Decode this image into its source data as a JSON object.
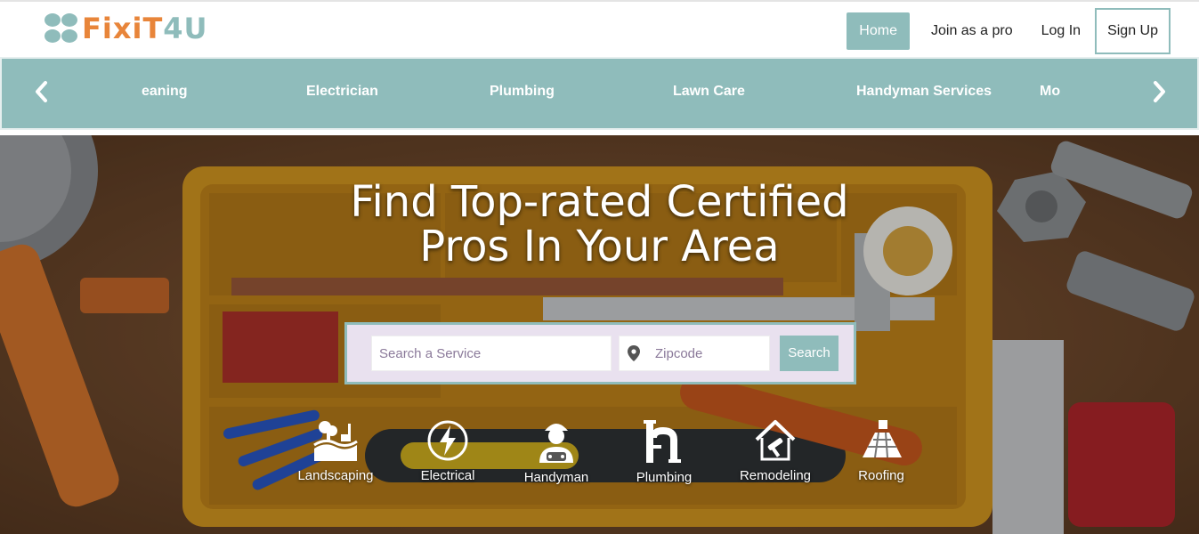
{
  "brand": {
    "part1": "FixiT",
    "part2": "4U",
    "color_primary": "#e8853a",
    "color_secondary": "#8fbcbb"
  },
  "nav": {
    "home": "Home",
    "join": "Join as a pro",
    "login": "Log In",
    "signup": "Sign Up"
  },
  "categories": {
    "prev_icon": "chevron-left-icon",
    "next_icon": "chevron-right-icon",
    "items": [
      "eaning",
      "Electrician",
      "Plumbing",
      "Lawn Care",
      "Handyman Services",
      "Mo"
    ]
  },
  "hero": {
    "title_line1": "Find Top-rated Certified",
    "title_line2": "Pros In Your Area"
  },
  "search": {
    "service_placeholder": "Search a Service",
    "zip_placeholder": "Zipcode",
    "button": "Search"
  },
  "services": [
    {
      "label": "Landscaping",
      "icon": "landscaping-icon"
    },
    {
      "label": "Electrical",
      "icon": "lightning-icon"
    },
    {
      "label": "Handyman",
      "icon": "handyman-icon"
    },
    {
      "label": "Plumbing",
      "icon": "pipe-icon"
    },
    {
      "label": "Remodeling",
      "icon": "house-hammer-icon"
    },
    {
      "label": "Roofing",
      "icon": "roof-icon"
    }
  ],
  "colors": {
    "accent": "#8fbcbb",
    "search_panel": "#e9e1ef",
    "white": "#ffffff"
  }
}
